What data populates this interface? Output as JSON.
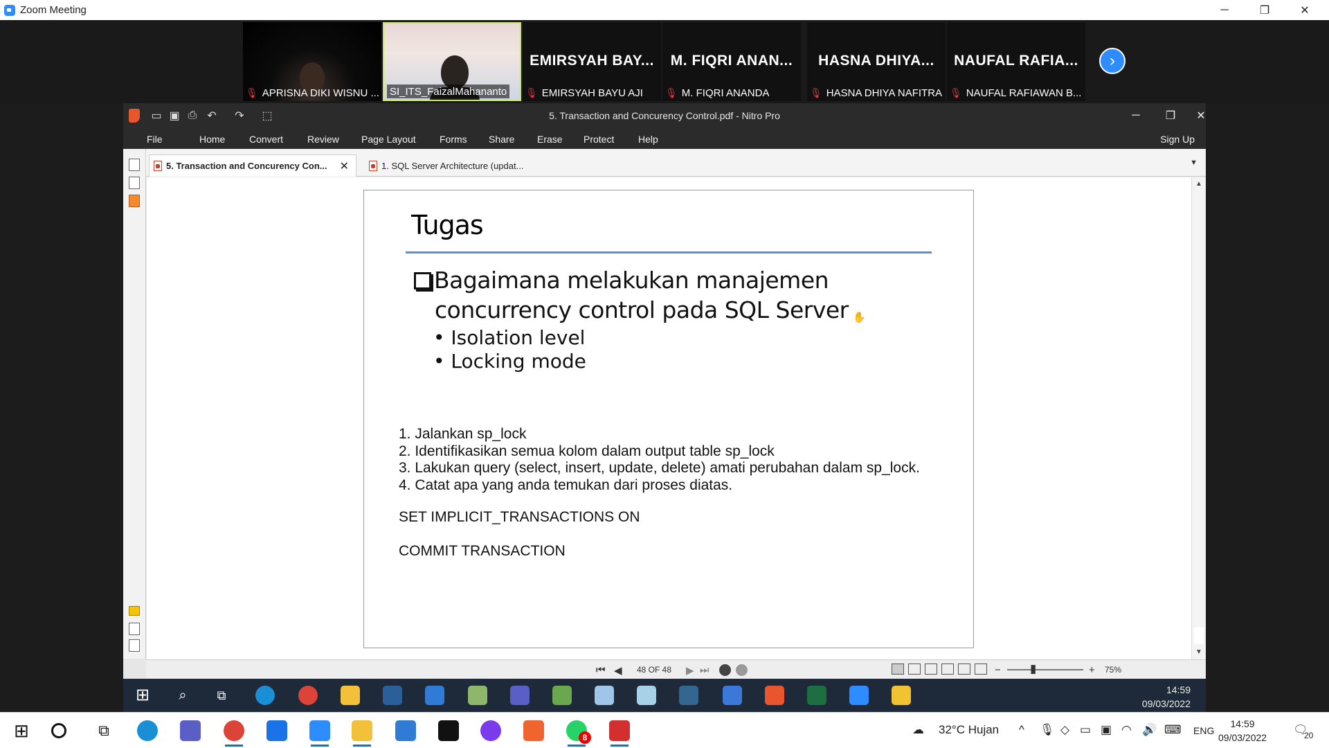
{
  "zoom": {
    "window_title": "Zoom Meeting",
    "controls": {
      "minimize": "─",
      "restore": "❐",
      "close": "✕"
    },
    "participants": [
      {
        "label": "APRISNA DIKI WISNU ...",
        "big_name": ""
      },
      {
        "label": "SI_ITS_FaizalMahananto",
        "big_name": ""
      },
      {
        "label": "EMIRSYAH BAYU AJI",
        "big_name": "EMIRSYAH BAY..."
      },
      {
        "label": "M. FIQRI ANANDA",
        "big_name": "M. FIQRI ANAN..."
      },
      {
        "label": "HASNA DHIYA NAFITRA",
        "big_name": "HASNA DHIYA..."
      },
      {
        "label": "NAUFAL RAFIAWAN B...",
        "big_name": "NAUFAL RAFIA..."
      }
    ],
    "next_glyph": "›",
    "mic_glyph": "🎙"
  },
  "nitro": {
    "doc_title": "5. Transaction and Concurency Control.pdf - Nitro Pro",
    "menu": [
      "File",
      "Home",
      "Convert",
      "Review",
      "Page Layout",
      "Forms",
      "Share",
      "Erase",
      "Protect",
      "Help"
    ],
    "sign_up": "Sign Up",
    "tabs": [
      {
        "label": "5. Transaction and Concurency Con...",
        "close": "✕"
      },
      {
        "label": "1. SQL Server Architecture (updat..."
      }
    ],
    "status": {
      "page_indicator": "48 OF 48",
      "zoom_minus": "−",
      "zoom_plus": "+",
      "zoom_level": "75%"
    }
  },
  "slide": {
    "title": "Tugas",
    "question_line1": "Bagaimana melakukan manajemen",
    "question_line2": "concurrency control pada SQL Server",
    "bullets": [
      "Isolation level",
      "Locking mode"
    ],
    "steps": [
      "1. Jalankan sp_lock",
      "2. Identifikasikan semua kolom dalam output table sp_lock",
      "3. Lakukan query (select, insert, update, delete) amati perubahan dalam sp_lock.",
      "4. Catat apa yang anda temukan dari proses diatas."
    ],
    "sql1": "SET IMPLICIT_TRANSACTIONS ON",
    "sql2": "COMMIT TRANSACTION"
  },
  "inner_taskbar": {
    "time": "14:59",
    "date": "09/03/2022"
  },
  "host_taskbar": {
    "weather": "32°C  Hujan",
    "lang": "ENG",
    "time": "14:59",
    "date": "09/03/2022",
    "notifications": "20",
    "whatsapp_badge": "8"
  }
}
